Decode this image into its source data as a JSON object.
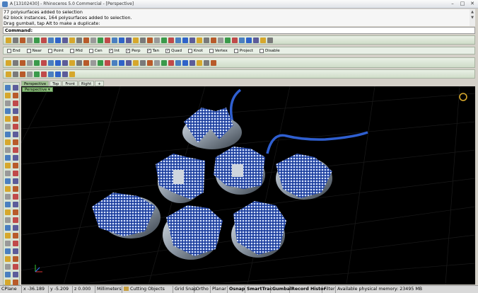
{
  "window": {
    "title": "A [13102430] - Rhinoceros 5.0 Commercial - [Perspective]",
    "controls": [
      "–",
      "□",
      "✕"
    ]
  },
  "history": {
    "line1": "77 polysurfaces added to selection",
    "line2": "62 block instances, 164 polysurfaces added to selection.",
    "line3": "Drag gumball, tap Alt to make a duplicate:"
  },
  "command": {
    "label": "Command:",
    "value": ""
  },
  "osnaps": [
    {
      "label": "End",
      "checked": false
    },
    {
      "label": "Near",
      "checked": false
    },
    {
      "label": "Point",
      "checked": false
    },
    {
      "label": "Mid",
      "checked": false
    },
    {
      "label": "Cen",
      "checked": false
    },
    {
      "label": "Int",
      "checked": true
    },
    {
      "label": "Perp",
      "checked": true
    },
    {
      "label": "Tan",
      "checked": true
    },
    {
      "label": "Quad",
      "checked": true
    },
    {
      "label": "Knot",
      "checked": false
    },
    {
      "label": "Vertex",
      "checked": false
    },
    {
      "label": "Project",
      "checked": false
    },
    {
      "label": "Disable",
      "checked": false
    }
  ],
  "viewport_tabs": [
    "Perspective",
    "Top",
    "Front",
    "Right"
  ],
  "viewport_label": "Perspective",
  "statusbar": {
    "cplane": "CPlane",
    "x": "x -36.189",
    "y": "y -5.209",
    "z": "z 0.000",
    "units": "Millimeters",
    "layer": "Cutting Objects",
    "grid_snap": "Grid Snap",
    "ortho": "Ortho",
    "planar": "Planar",
    "osnap": "Osnap",
    "smarttrack": "SmartTrac",
    "gumball": "Gumbal",
    "record_history": "Record Histor",
    "filter": "Filter",
    "memory": "Available physical memory: 23495 MB"
  },
  "colors": {
    "toolbar_green": "#cfdcc8",
    "viewport_bg": "#000000",
    "model_blue": "#2f63c9",
    "model_metal": "#8c97a3",
    "active_tab": "#8cbf7a"
  }
}
